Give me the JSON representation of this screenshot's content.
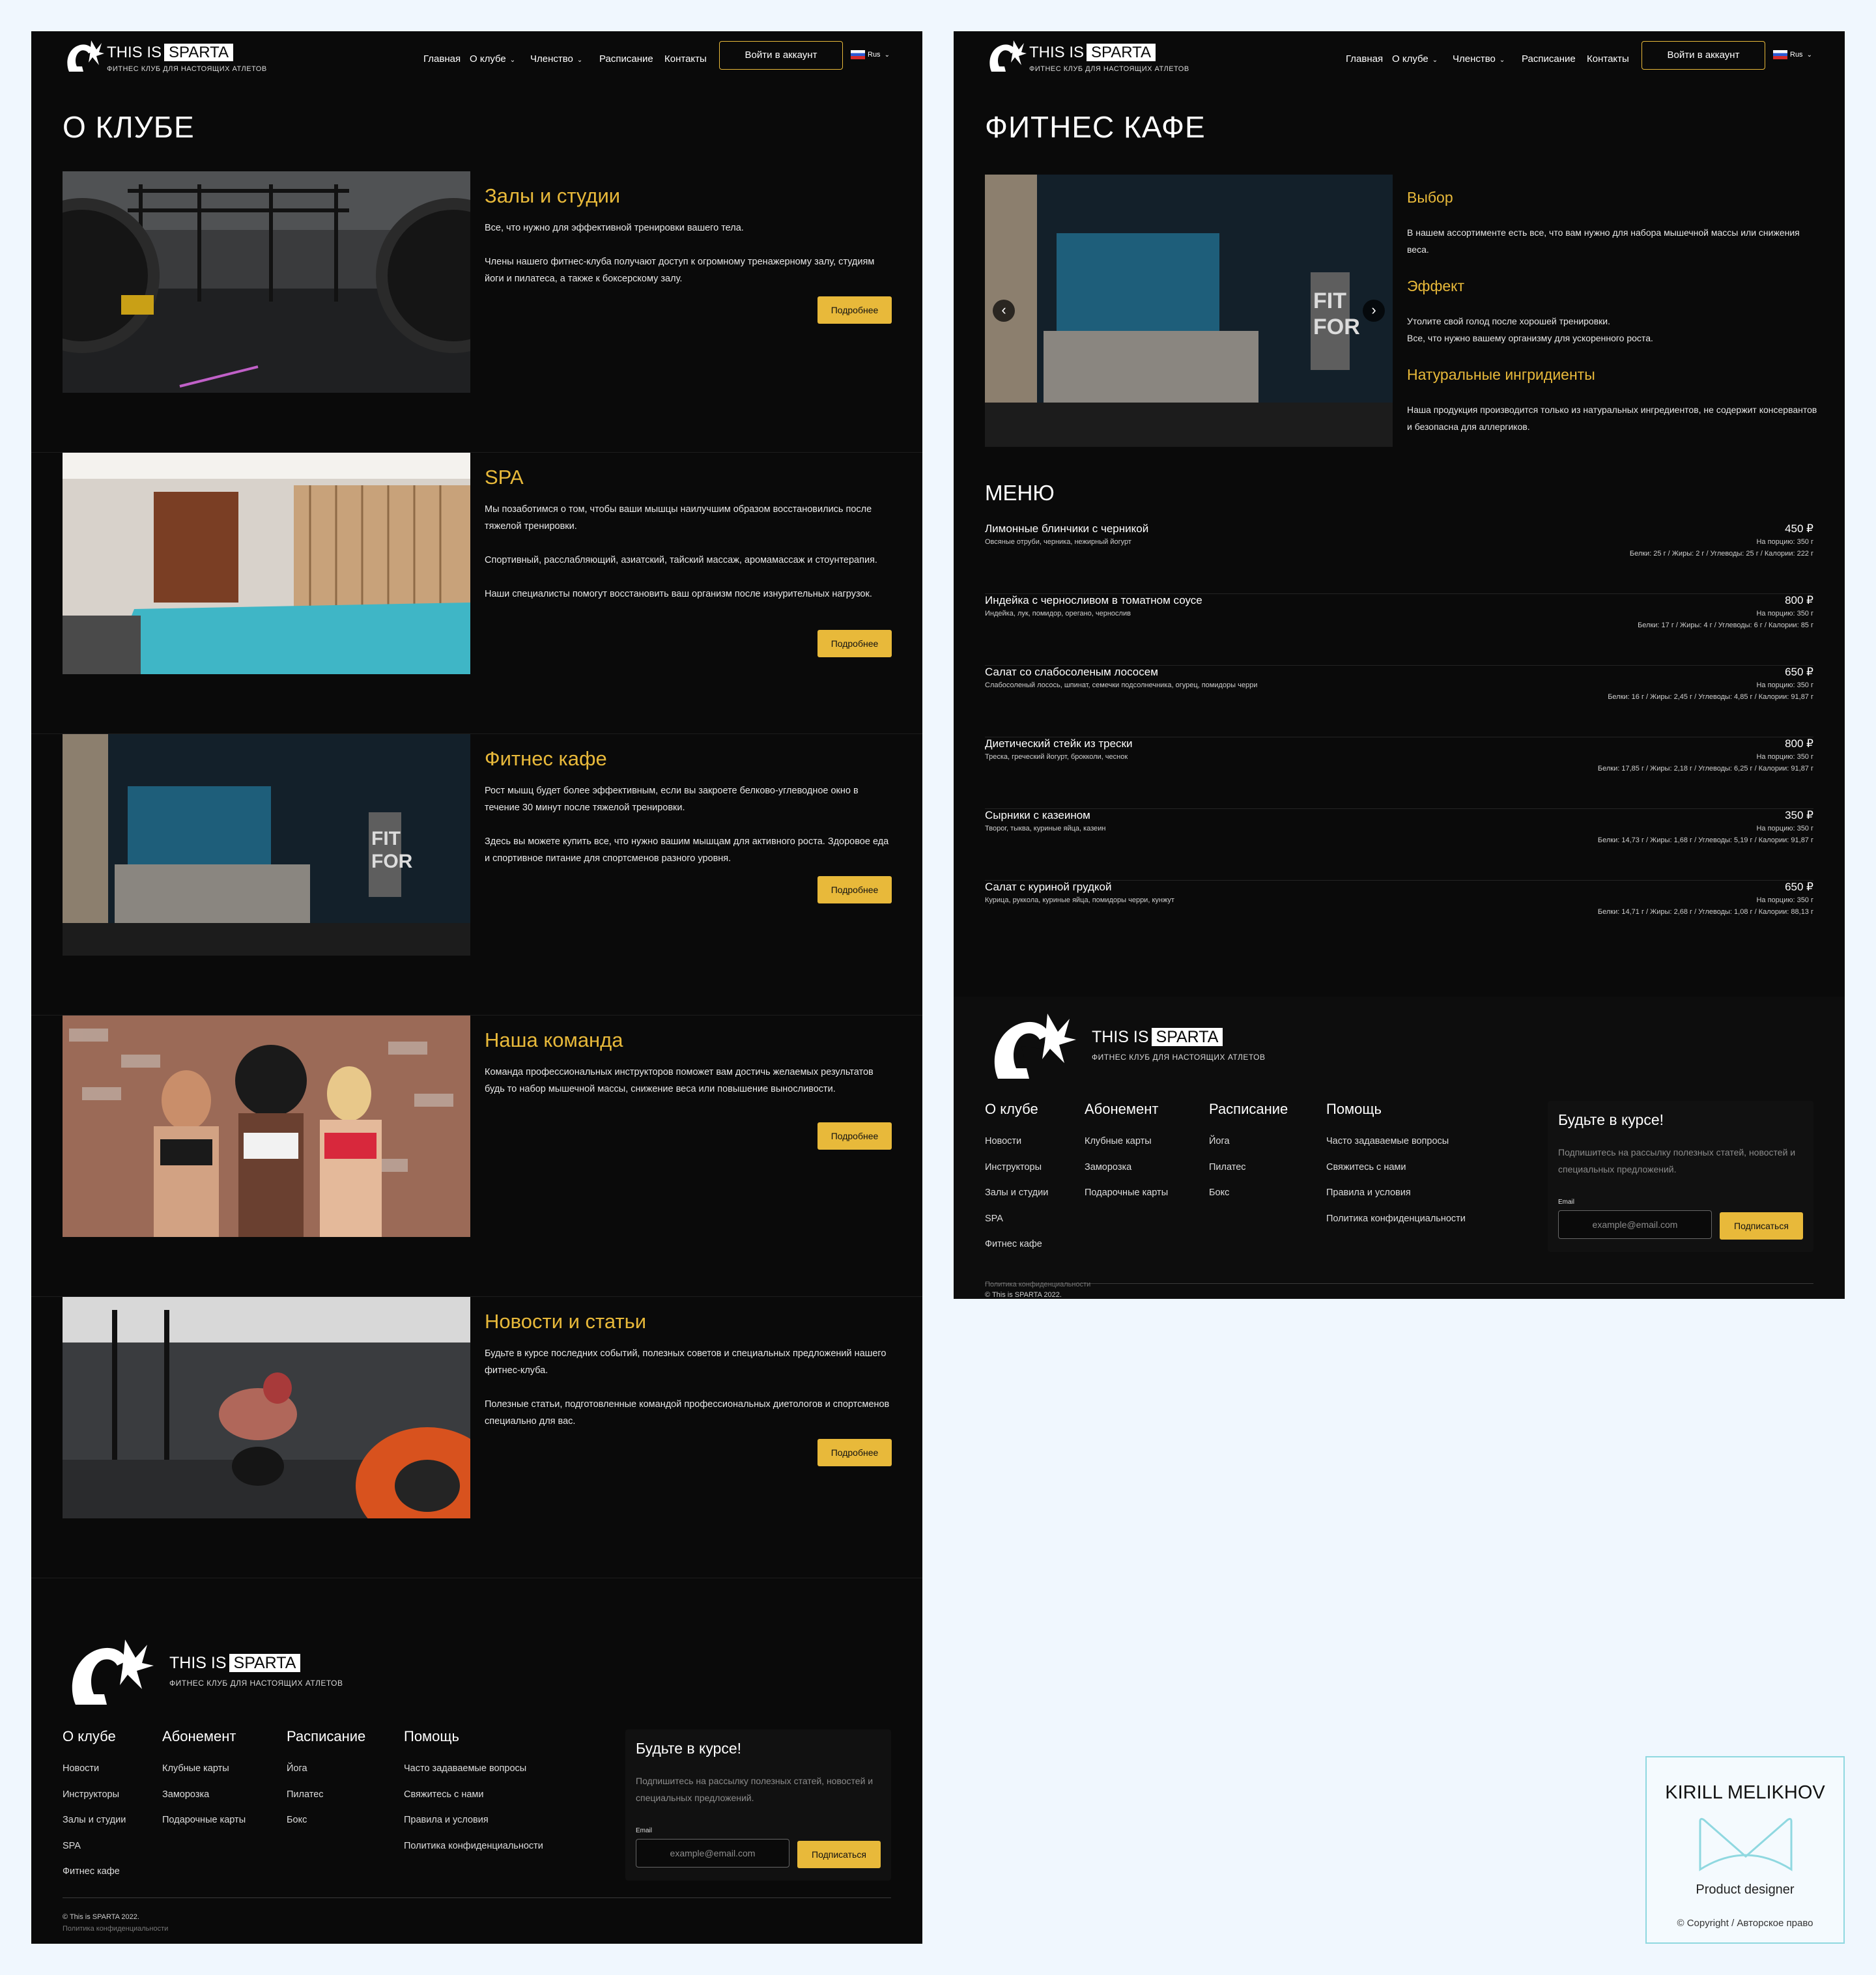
{
  "brand": {
    "logo_this_is": "THIS IS",
    "logo_sparta": "SPARTA",
    "tagline": "ФИТНЕС КЛУБ ДЛЯ НАСТОЯЩИХ АТЛЕТОВ"
  },
  "nav": {
    "home": "Главная",
    "about": "О клубе",
    "membership": "Членство",
    "schedule": "Расписание",
    "contacts": "Контакты",
    "login": "Войти в аккаунт",
    "lang": "Rus"
  },
  "about_page": {
    "title": "О КЛУБЕ",
    "more_label": "Подробнее",
    "sections": [
      {
        "title": "Залы и студии",
        "p1": "Все, что нужно для эффективной тренировки вашего  тела.",
        "p2": "Члены нашего фитнес-клуба получают доступ к огромному тренажерному залу, студиям йоги и пилатеса, а также к боксерскому залу.",
        "p3": ""
      },
      {
        "title": "SPA",
        "p1": "Мы позаботимся о том, чтобы ваши мышцы наилучшим образом восстановились после тяжелой тренировки.",
        "p2": "Спортивный, расслабляющий, азиатский, тайский массаж, аромамассаж и стоунтерапия.",
        "p3": "Наши специалисты помогут восстановить ваш организм после изнурительных нагрузок."
      },
      {
        "title": "Фитнес кафе",
        "p1": "Рост мышц будет более эффективным, если вы закроете белково-углеводное окно в течение 30 минут после тяжелой тренировки.",
        "p2": "Здесь вы можете купить все, что нужно вашим мышцам для активного роста. Здоровое еда и спортивное питание для спортсменов разного уровня.",
        "p3": ""
      },
      {
        "title": "Наша команда",
        "p1": "Команда профессиональных инструкторов поможет вам достичь желаемых результатов будь то набор мышечной массы, снижение веса или повышение выносливости.",
        "p2": "",
        "p3": ""
      },
      {
        "title": "Новости и статьи",
        "p1": "Будьте в курсе последних событий, полезных советов и специальных предложений нашего фитнес-клуба.",
        "p2": "Полезные статьи, подготовленные командой профессиональных диетологов и спортсменов специально для вас.",
        "p3": ""
      }
    ]
  },
  "cafe_page": {
    "title": "ФИТНЕС КАФЕ",
    "slider": {
      "prev": "‹",
      "next": "›",
      "active_slide": 1,
      "slides": 2
    },
    "side": [
      {
        "title": "Выбор",
        "text": "В нашем ассортименте есть все, что вам нужно для набора мышечной массы или снижения веса."
      },
      {
        "title": "Эффект",
        "text": "Утолите свой голод после хорошей тренировки.\nВсе, что нужно вашему организму для ускоренного роста."
      },
      {
        "title": "Натуральные ингридиенты",
        "text": "Наша продукция производится только из натуральных ингредиентов, не содержит консервантов и безопасна для аллергиков."
      }
    ],
    "menu_title": "МЕНЮ",
    "menu": [
      {
        "name": "Лимонные блинчики с черникой",
        "ingredients": "Овсяные отруби, черника, нежирный йогурт",
        "price": "450 ₽",
        "portion": "На порцию: 350 г",
        "nutrition": "Белки: 25 г / Жиры: 2 г / Углеводы: 25 г / Калории: 222 г"
      },
      {
        "name": "Индейка с черносливом в томатном соусе",
        "ingredients": "Индейка, лук, помидор, орегано, чернослив",
        "price": "800 ₽",
        "portion": "На порцию: 350 г",
        "nutrition": "Белки: 17 г / Жиры: 4 г / Углеводы: 6 г / Калории: 85 г"
      },
      {
        "name": "Салат со слабосоленым лососем",
        "ingredients": "Слабосоленый лосось, шпинат, семечки подсолнечника, огурец, помидоры черри",
        "price": "650 ₽",
        "portion": "На порцию: 350 г",
        "nutrition": "Белки: 16 г / Жиры: 2,45 г / Углеводы: 4,85 г / Калории: 91,87 г"
      },
      {
        "name": "Диетический стейк из трески",
        "ingredients": "Треска, греческий йогурт, брокколи, чеснок",
        "price": "800 ₽",
        "portion": "На порцию: 350 г",
        "nutrition": "Белки: 17,85 г / Жиры: 2,18 г / Углеводы: 6,25 г / Калории: 91,87 г"
      },
      {
        "name": "Сырники с казеином",
        "ingredients": "Творог, тыква, куриные яйца, казеин",
        "price": "350 ₽",
        "portion": "На порцию: 350 г",
        "nutrition": "Белки: 14,73 г / Жиры: 1,68 г / Углеводы: 5,19 г / Калории: 91,87 г"
      },
      {
        "name": "Салат с куриной грудкой",
        "ingredients": "Курица, руккола, куриные яйца, помидоры черри, кунжут",
        "price": "650 ₽",
        "portion": "На порцию: 350 г",
        "nutrition": "Белки: 14,71 г / Жиры: 2,68 г / Углеводы: 1,08 г / Калории: 88,13 г"
      }
    ]
  },
  "footer": {
    "cols": [
      {
        "title": "О клубе",
        "items": [
          "Новости",
          "Инструкторы",
          "Залы и студии",
          "SPA",
          "Фитнес кафе"
        ]
      },
      {
        "title": "Абонемент",
        "items": [
          "Клубные карты",
          "Заморозка",
          "Подарочные карты"
        ]
      },
      {
        "title": "Расписание",
        "items": [
          "Йога",
          "Пилатес",
          "Бокс"
        ]
      },
      {
        "title": "Помощь",
        "items": [
          "Часто задаваемые вопросы",
          "Свяжитесь с нами",
          "Правила и условия",
          "Политика конфиденциальности"
        ]
      }
    ],
    "newsletter": {
      "title": "Будьте в курсе!",
      "text": "Подпишитесь на рассылку полезных статей, новостей и специальных предложений.",
      "email_label": "Email",
      "email_placeholder": "example@email.com",
      "button": "Подписаться"
    },
    "copyright": "© This is SPARTA 2022.",
    "privacy": "Политика конфиденциальности"
  },
  "designer_card": {
    "name": "KIRILL MELIKHOV",
    "role": "Product designer",
    "copyright": "© Copyright / Авторское право"
  },
  "colors": {
    "accent": "#e8b93a",
    "background": "#0a0a0a",
    "canvas": "#f0f7fe",
    "card_border": "#8fd8e0"
  }
}
